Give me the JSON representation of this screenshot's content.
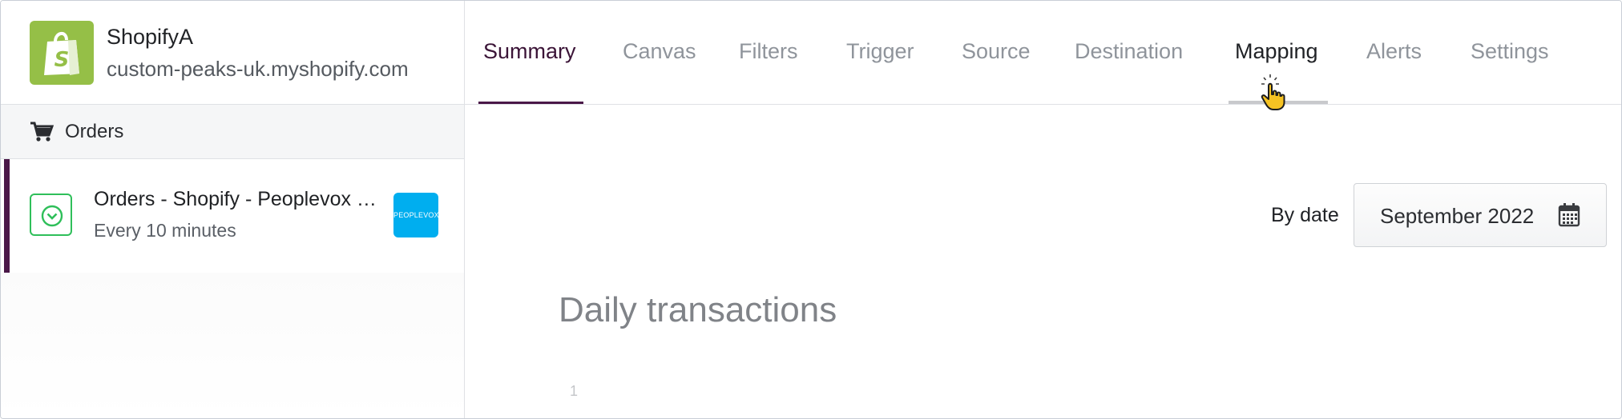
{
  "store": {
    "name": "ShopifyA",
    "domain": "custom-peaks-uk.myshopify.com",
    "logo_icon": "shopify-bag-icon",
    "logo_color": "#95bf47"
  },
  "sidebar": {
    "section": {
      "label": "Orders",
      "icon": "cart-icon"
    },
    "flows": [
      {
        "title": "Orders - Shopify - Peoplevox …",
        "schedule": "Every 10 minutes",
        "status_icon": "chevron-down-circle-icon",
        "status_color": "#2fbf5a",
        "app_logo_text": "PEOPLEVOX",
        "app_logo_color": "#00aeef",
        "accent_color": "#4a1848"
      }
    ]
  },
  "tabs": [
    {
      "label": "Summary",
      "state": "active"
    },
    {
      "label": "Canvas",
      "state": "default"
    },
    {
      "label": "Filters",
      "state": "default"
    },
    {
      "label": "Trigger",
      "state": "default"
    },
    {
      "label": "Source",
      "state": "default"
    },
    {
      "label": "Destination",
      "state": "default"
    },
    {
      "label": "Mapping",
      "state": "hovered"
    },
    {
      "label": "Alerts",
      "state": "default"
    },
    {
      "label": "Settings",
      "state": "default"
    }
  ],
  "filter": {
    "label": "By date",
    "value": "September 2022",
    "icon": "calendar-icon"
  },
  "main": {
    "section_title": "Daily transactions",
    "axis_tick": "1"
  },
  "colors": {
    "active_tab": "#3b1437",
    "accent": "#4a1848",
    "muted_tab": "#8f949b"
  }
}
